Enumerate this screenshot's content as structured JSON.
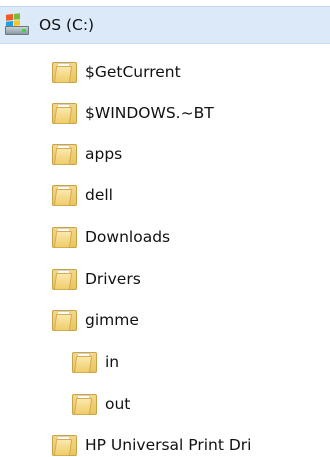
{
  "tree": {
    "root": {
      "label": "OS (C:)",
      "icon": "drive-icon",
      "selected": true
    },
    "items": [
      {
        "label": "$GetCurrent",
        "icon": "folder-icon",
        "level": 1
      },
      {
        "label": "$WINDOWS.~BT",
        "icon": "folder-icon",
        "level": 1
      },
      {
        "label": "apps",
        "icon": "folder-icon",
        "level": 1
      },
      {
        "label": "dell",
        "icon": "folder-icon",
        "level": 1
      },
      {
        "label": "Downloads",
        "icon": "folder-icon",
        "level": 1
      },
      {
        "label": "Drivers",
        "icon": "folder-icon",
        "level": 1
      },
      {
        "label": "gimme",
        "icon": "folder-icon",
        "level": 1
      },
      {
        "label": "in",
        "icon": "folder-icon",
        "level": 2
      },
      {
        "label": "out",
        "icon": "folder-icon",
        "level": 2
      },
      {
        "label": "HP Universal Print Dri",
        "icon": "folder-icon",
        "level": 1
      }
    ]
  },
  "colors": {
    "selection_bg": "#dbe9f8",
    "folder": "#f0cd6c",
    "text": "#111111"
  }
}
